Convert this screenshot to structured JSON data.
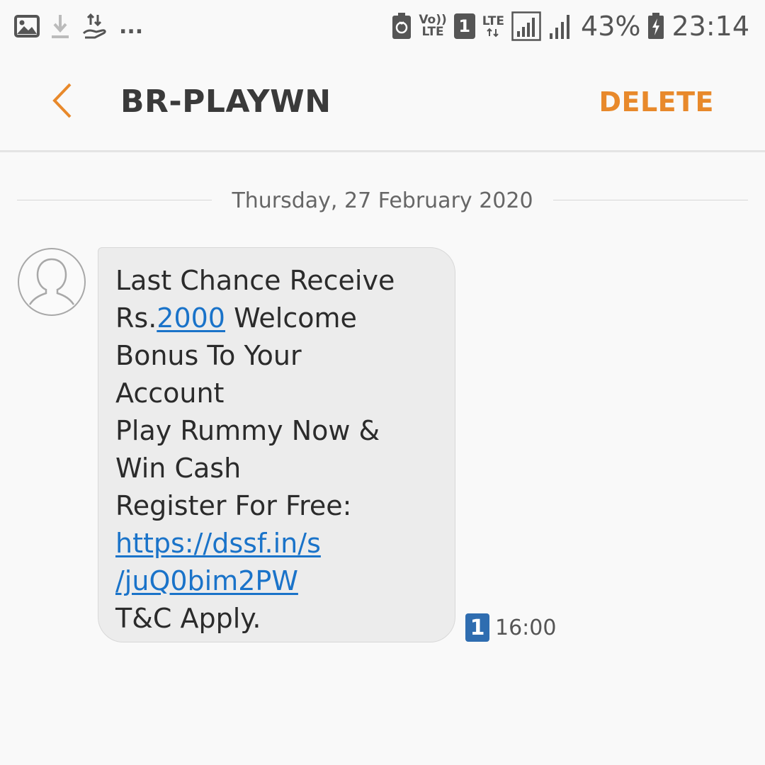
{
  "status_bar": {
    "icons_left": [
      "image-icon",
      "download-icon",
      "data-transfer-icon"
    ],
    "more": "...",
    "volte_top": "Vo))",
    "volte_bottom": "LTE",
    "sim_slot": "1",
    "lte_label": "LTE",
    "battery_percent": "43%",
    "time": "23:14"
  },
  "header": {
    "title": "BR-PLAYWN",
    "delete_label": "DELETE",
    "accent_color": "#e8892b"
  },
  "conversation": {
    "date": "Thursday, 27 February 2020",
    "messages": [
      {
        "line_1": "Last Chance Receive",
        "line_2_prefix": "Rs.",
        "line_2_amount": "2000",
        "line_2_suffix": " Welcome",
        "line_3": "Bonus To Your",
        "line_4": "Account",
        "line_5": "Play Rummy Now &",
        "line_6": "Win Cash",
        "line_7": "Register For Free:",
        "link_part_1": "https://dssf.in/s",
        "link_part_2": "/juQ0bim2PW",
        "line_10": "T&C Apply.",
        "sim_slot": "1",
        "time": "16:00",
        "link_color": "#1a73c9"
      }
    ]
  }
}
